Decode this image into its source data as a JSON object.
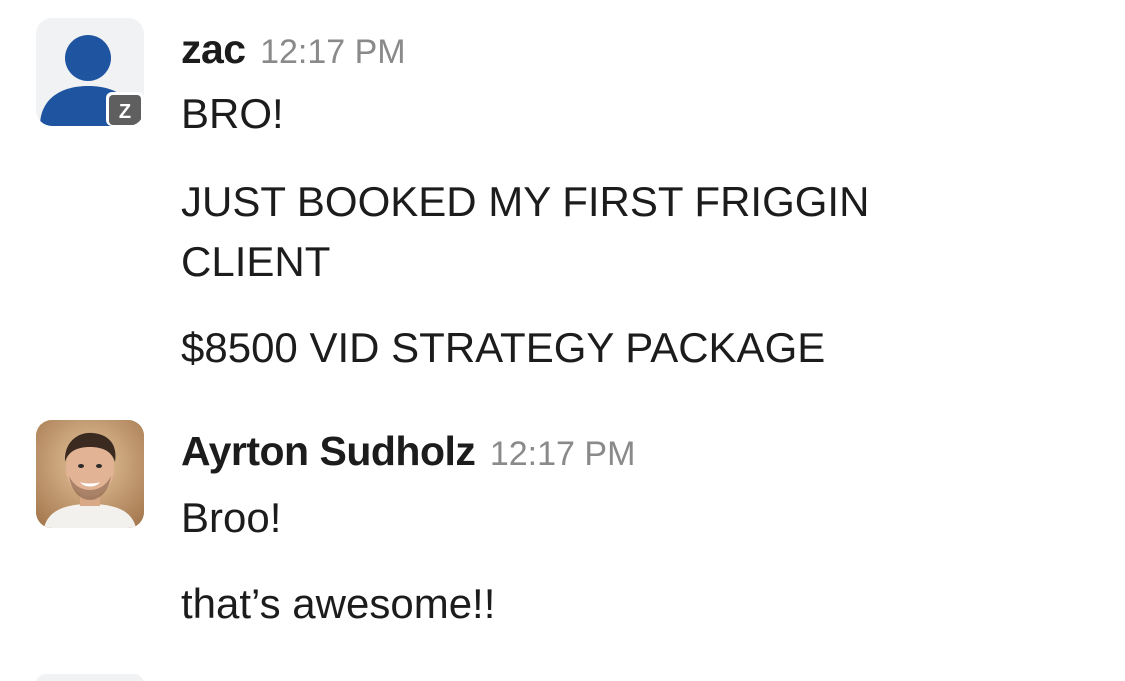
{
  "messages": [
    {
      "sender": "zac",
      "time": "12:17 PM",
      "avatar_badge": "Z",
      "avatar_icon": "user-silhouette-icon",
      "lines": [
        "BRO!",
        "JUST BOOKED MY FIRST FRIGGIN",
        "CLIENT",
        "$8500 VID STRATEGY PACKAGE"
      ]
    },
    {
      "sender": "Ayrton Sudholz",
      "time": "12:17 PM",
      "avatar_icon": "profile-photo",
      "lines": [
        "Broo!",
        "that’s awesome!!"
      ]
    }
  ],
  "colors": {
    "avatar_blue": "#1f55a0",
    "badge_gray": "#5f5f5f",
    "timestamp_gray": "#8a8a8a"
  }
}
